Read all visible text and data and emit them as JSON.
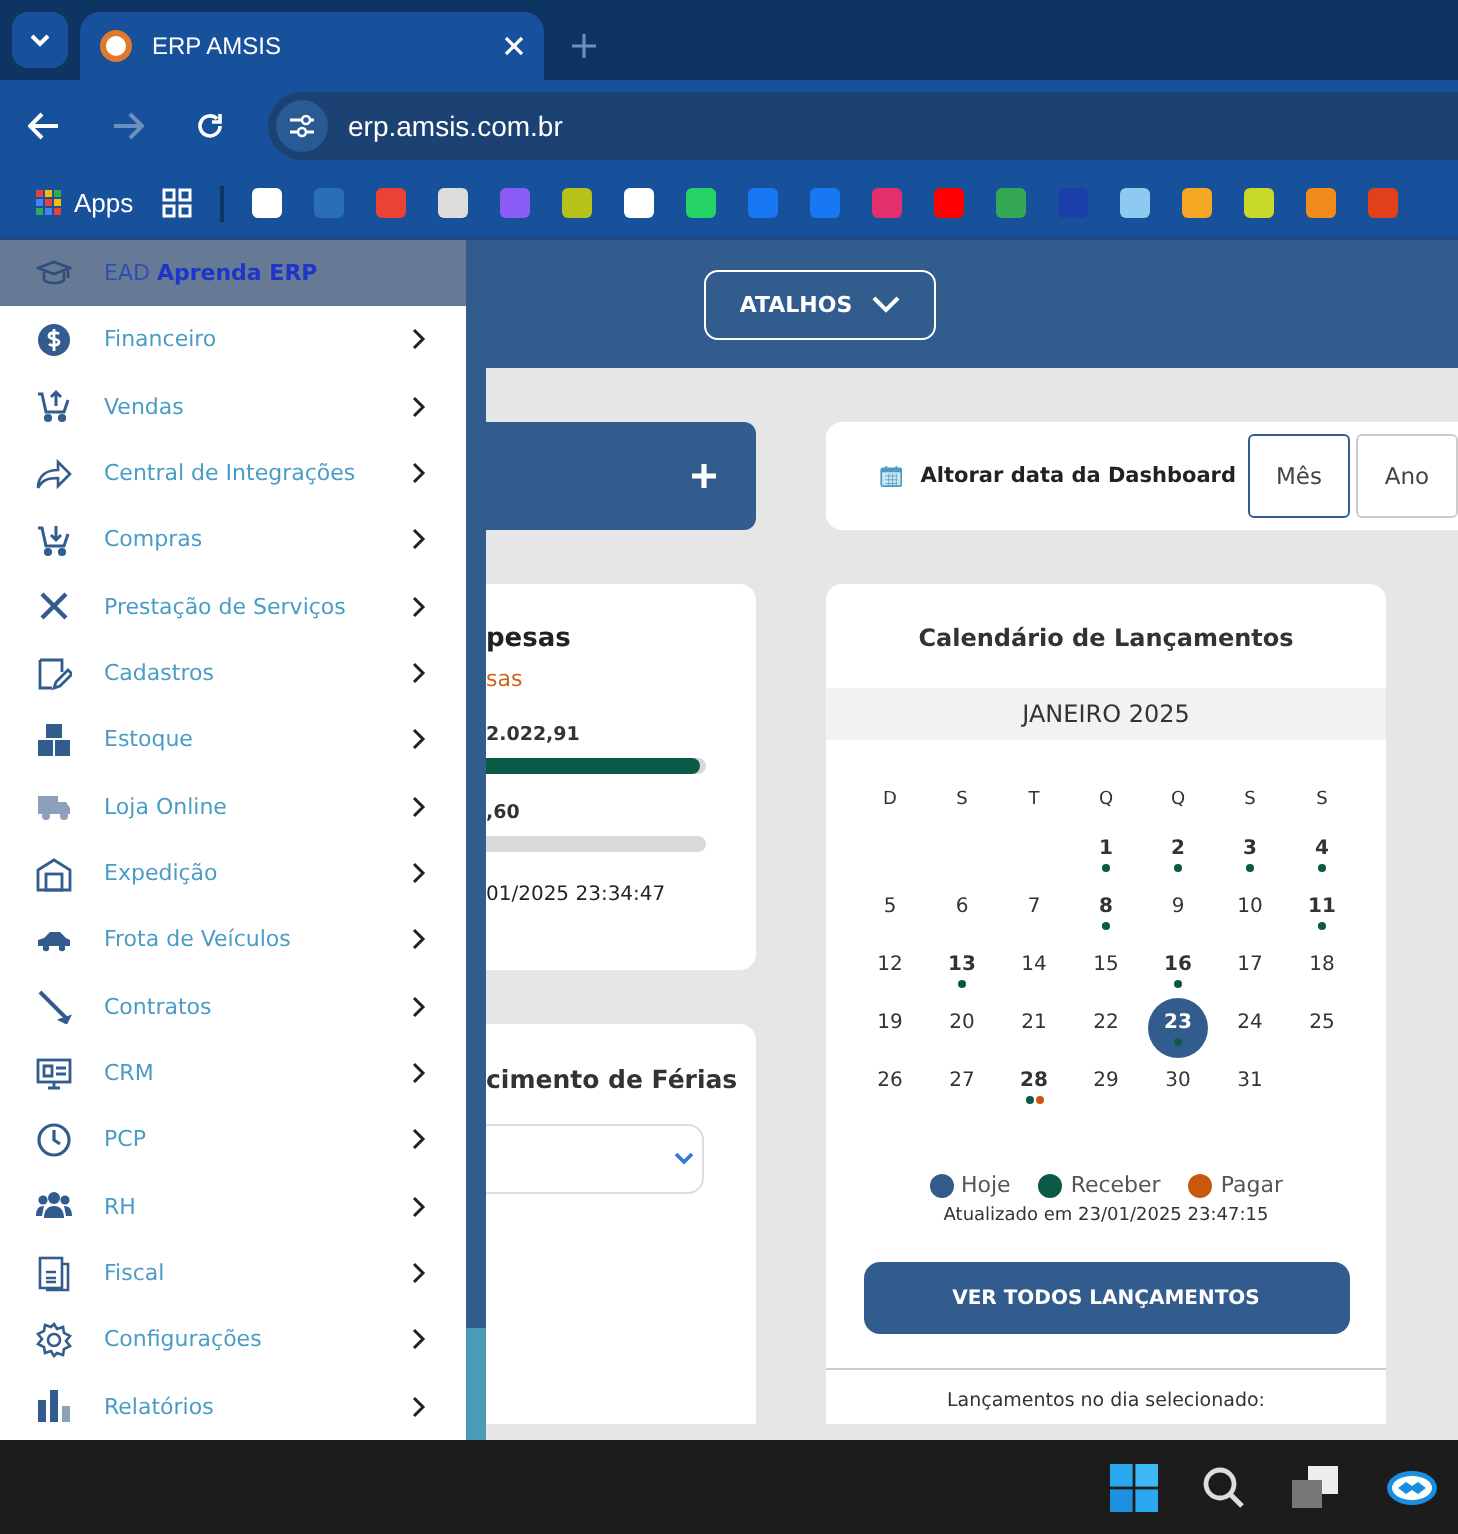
{
  "browser": {
    "tab_title": "ERP AMSIS",
    "url": "erp.amsis.com.br",
    "bookmarks_apps": "Apps"
  },
  "topbar": {
    "shortcuts": "ATALHOS"
  },
  "sidebar": {
    "items": [
      {
        "label": "EAD **Aprenda ERP**",
        "selected": true,
        "expandable": false
      },
      {
        "label": "Financeiro",
        "selected": false,
        "expandable": true
      },
      {
        "label": "Vendas",
        "selected": false,
        "expandable": true
      },
      {
        "label": "Central de Integrações",
        "selected": false,
        "expandable": true
      },
      {
        "label": "Compras",
        "selected": false,
        "expandable": true
      },
      {
        "label": "Prestação de Serviços",
        "selected": false,
        "expandable": true
      },
      {
        "label": "Cadastros",
        "selected": false,
        "expandable": true
      },
      {
        "label": "Estoque",
        "selected": false,
        "expandable": true
      },
      {
        "label": "Loja Online",
        "selected": false,
        "expandable": true
      },
      {
        "label": "Expedição",
        "selected": false,
        "expandable": true
      },
      {
        "label": "Frota de Veículos",
        "selected": false,
        "expandable": true
      },
      {
        "label": "Contratos",
        "selected": false,
        "expandable": true
      },
      {
        "label": "CRM",
        "selected": false,
        "expandable": true
      },
      {
        "label": "PCP",
        "selected": false,
        "expandable": true
      },
      {
        "label": "RH",
        "selected": false,
        "expandable": true
      },
      {
        "label": "Fiscal",
        "selected": false,
        "expandable": true
      },
      {
        "label": "Configurações",
        "selected": false,
        "expandable": true
      },
      {
        "label": "Relatórios",
        "selected": false,
        "expandable": true
      }
    ]
  },
  "expenses_card": {
    "title": "pesas",
    "subtitle": "sas",
    "bars": [
      {
        "amount": "2.022,91",
        "level": 0.97
      },
      {
        "amount": ",60",
        "level": 0
      }
    ],
    "updated": "01/2025 23:34:47"
  },
  "vacation_card": {
    "title": "cimento de Férias"
  },
  "date_filter": {
    "label": "Altorar data da Dashboard",
    "options": [
      {
        "label": "Mês",
        "selected": true
      },
      {
        "label": "Ano",
        "selected": false
      }
    ]
  },
  "calendar": {
    "title": "Calendário de Lançamentos",
    "month": "JANEIRO 2025",
    "weekdays": [
      "D",
      "S",
      "T",
      "Q",
      "Q",
      "S",
      "S"
    ],
    "days": [
      {
        "label": "1",
        "today": false,
        "dots": [
          {
            "color": "#0b5a48"
          }
        ]
      },
      {
        "label": "2",
        "today": false,
        "dots": [
          {
            "color": "#0b5a48"
          }
        ]
      },
      {
        "label": "3",
        "today": false,
        "dots": [
          {
            "color": "#0b5a48"
          }
        ]
      },
      {
        "label": "4",
        "today": false,
        "dots": [
          {
            "color": "#0b5a48"
          }
        ]
      },
      {
        "label": "5",
        "today": false
      },
      {
        "label": "6",
        "today": false
      },
      {
        "label": "7",
        "today": false
      },
      {
        "label": "8",
        "today": false,
        "dots": [
          {
            "color": "#0b5a48"
          }
        ]
      },
      {
        "label": "9",
        "today": false
      },
      {
        "label": "10",
        "today": false
      },
      {
        "label": "11",
        "today": false,
        "dots": [
          {
            "color": "#0b5a48"
          }
        ]
      },
      {
        "label": "12",
        "today": false
      },
      {
        "label": "13",
        "today": false,
        "dots": [
          {
            "color": "#0b5a48"
          }
        ]
      },
      {
        "label": "14",
        "today": false
      },
      {
        "label": "15",
        "today": false
      },
      {
        "label": "16",
        "today": false,
        "dots": [
          {
            "color": "#0b5a48"
          }
        ]
      },
      {
        "label": "17",
        "today": false
      },
      {
        "label": "18",
        "today": false
      },
      {
        "label": "19",
        "today": false
      },
      {
        "label": "20",
        "today": false
      },
      {
        "label": "21",
        "today": false
      },
      {
        "label": "22",
        "today": false
      },
      {
        "label": "23",
        "today": true,
        "dots": [
          {
            "color": "#0b5a48"
          }
        ]
      },
      {
        "label": "24",
        "today": false
      },
      {
        "label": "25",
        "today": false
      },
      {
        "label": "26",
        "today": false
      },
      {
        "label": "27",
        "today": false
      },
      {
        "label": "28",
        "today": false,
        "dots": [
          {
            "color": "#0b5a48"
          },
          {
            "color": "#c9580f"
          }
        ]
      },
      {
        "label": "29",
        "today": false
      },
      {
        "label": "30",
        "today": false
      },
      {
        "label": "31",
        "today": false
      }
    ],
    "legend": [
      {
        "label": "Hoje",
        "color": "#335c8e"
      },
      {
        "label": "Receber",
        "color": "#0b5a48"
      },
      {
        "label": "Pagar",
        "color": "#c9580f"
      }
    ],
    "updated": "Atualizado em 23/01/2025 23:47:15",
    "button": "VER TODOS LANÇAMENTOS",
    "day_heading": "Lançamentos no dia selecionado:"
  }
}
